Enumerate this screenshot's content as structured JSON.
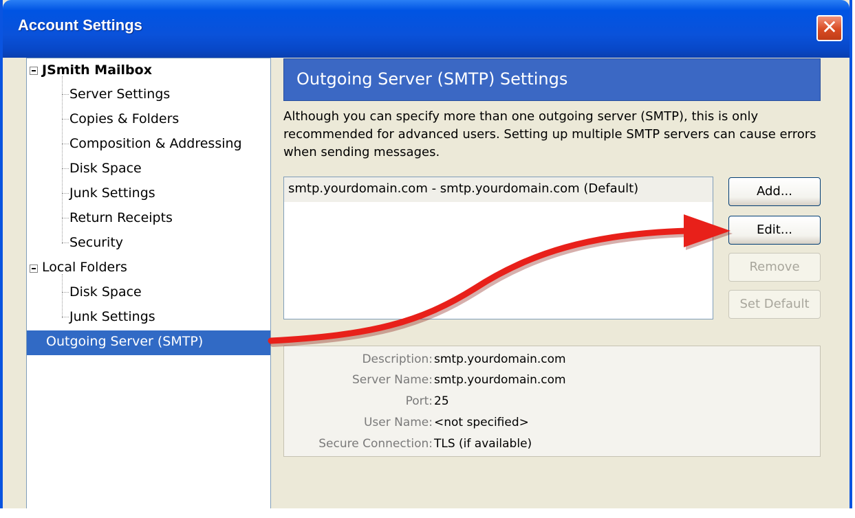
{
  "window": {
    "title": "Account Settings",
    "close_glyph": "✕"
  },
  "tree": {
    "account": {
      "label": "JSmith Mailbox",
      "children": [
        "Server Settings",
        "Copies & Folders",
        "Composition & Addressing",
        "Disk Space",
        "Junk Settings",
        "Return Receipts",
        "Security"
      ]
    },
    "local": {
      "label": "Local Folders",
      "children": [
        "Disk Space",
        "Junk Settings"
      ]
    },
    "selected_label": "Outgoing Server (SMTP)"
  },
  "panel": {
    "title": "Outgoing Server (SMTP) Settings",
    "description": "Although you can specify more than one outgoing server (SMTP), this is only recommended for advanced users. Setting up multiple SMTP servers can cause errors when sending messages.",
    "servers": [
      "smtp.yourdomain.com - smtp.yourdomain.com (Default)"
    ],
    "buttons": {
      "add": "Add...",
      "edit": "Edit...",
      "remove": "Remove",
      "set_default": "Set Default"
    },
    "details": {
      "description_label": "Description:",
      "description_value": "smtp.yourdomain.com",
      "server_name_label": "Server Name:",
      "server_name_value": "smtp.yourdomain.com",
      "port_label": "Port:",
      "port_value": "25",
      "user_name_label": "User Name:",
      "user_name_value": "<not specified>",
      "secure_label": "Secure Connection:",
      "secure_value": "TLS (if available)"
    }
  },
  "colors": {
    "titlebar": "#0054e3",
    "selection": "#316ac5",
    "header": "#3b68c4",
    "annotation_arrow": "#e8201a"
  }
}
